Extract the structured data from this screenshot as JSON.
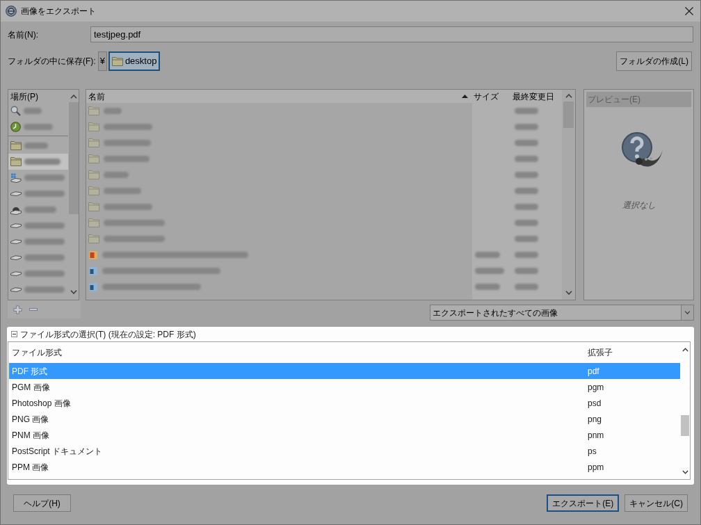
{
  "window": {
    "title": "画像をエクスポート"
  },
  "name_field": {
    "label": "名前(N):",
    "value": "testjpeg.pdf"
  },
  "save_in": {
    "label": "フォルダの中に保存(F):",
    "path": [
      {
        "kind": "root",
        "label": "¥",
        "selected": false
      },
      {
        "kind": "folder",
        "label": "desktop",
        "selected": true
      }
    ],
    "create_folder": "フォルダの作成(L)"
  },
  "places": {
    "header": "場所(P)",
    "groups": [
      {
        "items": [
          {
            "kind": "search",
            "selected": false
          },
          {
            "kind": "recent",
            "selected": false
          }
        ]
      },
      {
        "items": [
          {
            "kind": "folder",
            "selected": false
          },
          {
            "kind": "folder",
            "selected": true
          },
          {
            "kind": "system_drive",
            "selected": false
          },
          {
            "kind": "drive",
            "selected": false
          },
          {
            "kind": "optical_drive",
            "selected": false
          },
          {
            "kind": "drive",
            "selected": false
          },
          {
            "kind": "drive",
            "selected": false
          },
          {
            "kind": "drive",
            "selected": false
          },
          {
            "kind": "drive",
            "selected": false
          },
          {
            "kind": "drive",
            "selected": false
          }
        ]
      }
    ]
  },
  "files": {
    "columns": [
      {
        "label": "名前",
        "sorted": true
      },
      {
        "label": "サイズ",
        "sorted": false
      },
      {
        "label": "最終変更日",
        "sorted": false
      }
    ],
    "rows": [
      {
        "kind": "folder"
      },
      {
        "kind": "folder"
      },
      {
        "kind": "folder"
      },
      {
        "kind": "folder"
      },
      {
        "kind": "folder"
      },
      {
        "kind": "folder"
      },
      {
        "kind": "folder"
      },
      {
        "kind": "folder"
      },
      {
        "kind": "folder"
      },
      {
        "kind": "png"
      },
      {
        "kind": "jpg"
      },
      {
        "kind": "jpg"
      }
    ]
  },
  "preview": {
    "header": "プレビュー(E)",
    "message": "選択なし"
  },
  "filter": {
    "value": "エクスポートされたすべての画像"
  },
  "file_type": {
    "expanded": true,
    "label": "ファイル形式の選択(T) (現在の設定: PDF 形式)",
    "columns": [
      "ファイル形式",
      "拡張子"
    ],
    "rows": [
      {
        "name": "PDF 形式",
        "extension": "pdf",
        "selected": true
      },
      {
        "name": "PGM 画像",
        "extension": "pgm",
        "selected": false
      },
      {
        "name": "Photoshop 画像",
        "extension": "psd",
        "selected": false
      },
      {
        "name": "PNG 画像",
        "extension": "png",
        "selected": false
      },
      {
        "name": "PNM 画像",
        "extension": "pnm",
        "selected": false
      },
      {
        "name": "PostScript ドキュメント",
        "extension": "ps",
        "selected": false
      },
      {
        "name": "PPM 画像",
        "extension": "ppm",
        "selected": false
      }
    ]
  },
  "buttons": [
    {
      "kind": "help",
      "label": "ヘルプ(H)",
      "default": false
    },
    {
      "kind": "export",
      "label": "エクスポート(E)",
      "default": true
    },
    {
      "kind": "cancel",
      "label": "キャンセル(C)",
      "default": false
    }
  ]
}
